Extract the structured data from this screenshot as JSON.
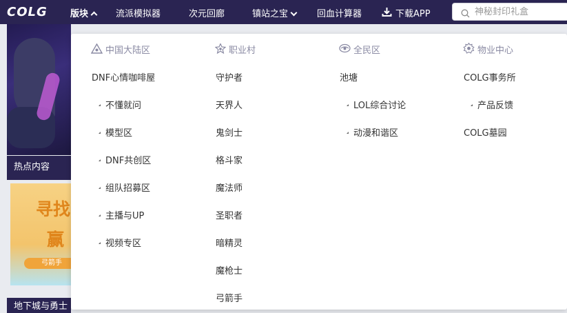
{
  "header": {
    "logo": "COLG",
    "nav": [
      {
        "label": "版块",
        "active": true
      },
      {
        "label": "流派模拟器"
      },
      {
        "label": "次元回廊"
      },
      {
        "label": "镇站之宝"
      },
      {
        "label": "回血计算器"
      },
      {
        "label": "下载APP"
      }
    ],
    "search_placeholder": "神秘封印礼盒"
  },
  "background": {
    "hot_title": "热点内容",
    "promo_line1": "寻找",
    "promo_line2": "赢",
    "promo_tag": "弓箭手",
    "bottom_title": "地下城与勇士"
  },
  "menu": {
    "columns": [
      {
        "title": "中国大陆区",
        "icon": "triangle-icon",
        "items": [
          {
            "label": "DNF心情咖啡屋",
            "sub": false
          },
          {
            "label": "不懂就问",
            "sub": true
          },
          {
            "label": "模型区",
            "sub": true
          },
          {
            "label": "DNF共创区",
            "sub": true
          },
          {
            "label": "组队招募区",
            "sub": true
          },
          {
            "label": "主播与UP",
            "sub": true
          },
          {
            "label": "视频专区",
            "sub": true
          }
        ]
      },
      {
        "title": "职业村",
        "icon": "star-icon",
        "items": [
          {
            "label": "守护者",
            "sub": false
          },
          {
            "label": "天界人",
            "sub": false
          },
          {
            "label": "鬼剑士",
            "sub": false
          },
          {
            "label": "格斗家",
            "sub": false
          },
          {
            "label": "魔法师",
            "sub": false
          },
          {
            "label": "圣职者",
            "sub": false
          },
          {
            "label": "暗精灵",
            "sub": false
          },
          {
            "label": "魔枪士",
            "sub": false
          },
          {
            "label": "弓箭手",
            "sub": false
          }
        ]
      },
      {
        "title": "全民区",
        "icon": "eye-icon",
        "items": [
          {
            "label": "池塘",
            "sub": false
          },
          {
            "label": "LOL综合讨论",
            "sub": true
          },
          {
            "label": "动漫和谐区",
            "sub": true
          }
        ]
      },
      {
        "title": "物业中心",
        "icon": "gear-icon",
        "items": [
          {
            "label": "COLG事务所",
            "sub": false
          },
          {
            "label": "产品反馈",
            "sub": true
          },
          {
            "label": "COLG墓园",
            "sub": false
          }
        ]
      }
    ]
  },
  "colors": {
    "nav_bg": "#2a2452",
    "menu_text": "#333333",
    "header_text": "#8a8aa3"
  }
}
